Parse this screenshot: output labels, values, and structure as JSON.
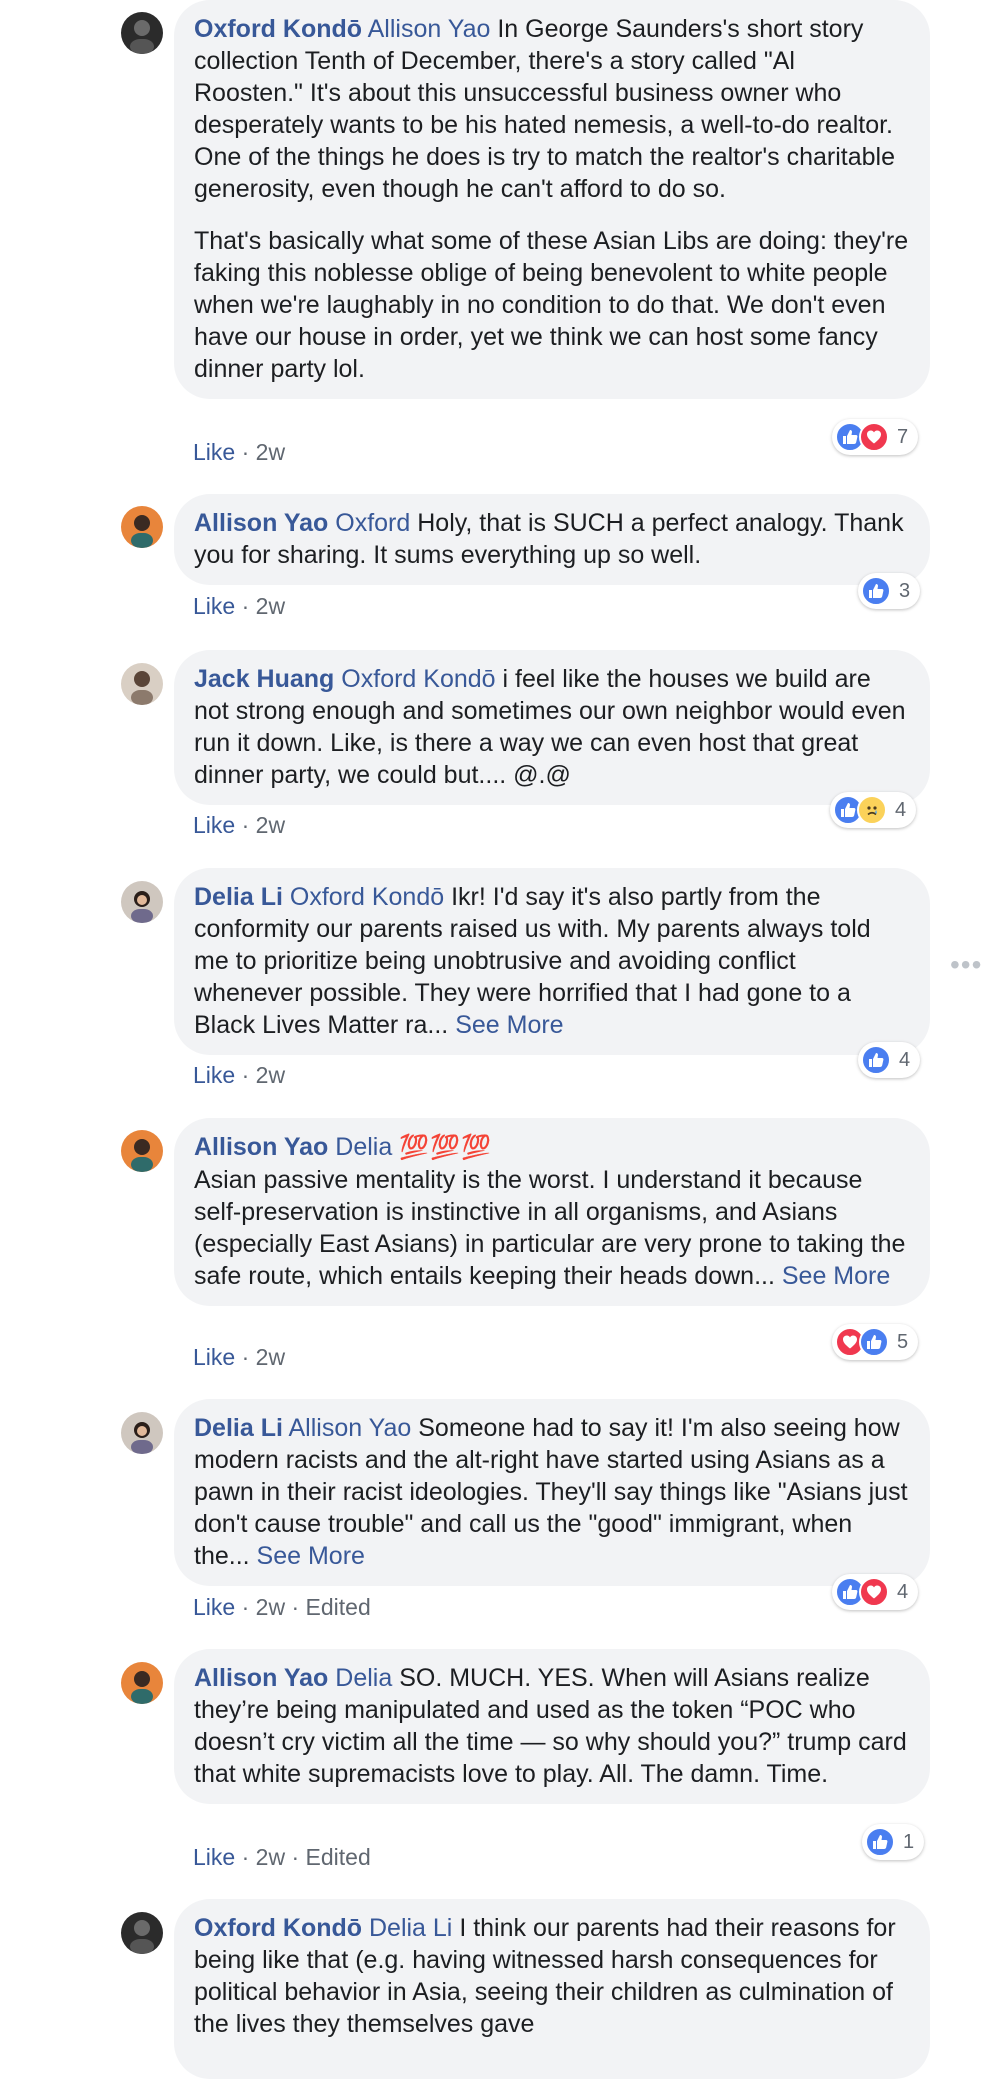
{
  "comments": [
    {
      "author": "Oxford Kondō",
      "mention": "Allison Yao",
      "paragraphs": [
        "In George Saunders's short story collection Tenth of December, there's a story called \"Al Roosten.\" It's about this unsuccessful business owner who desperately wants to be his hated nemesis, a well-to-do realtor. One of the things he does is try to match the realtor's charitable generosity, even though he can't afford to do so.",
        "That's basically what some of these Asian Libs are doing: they're faking this noblesse oblige of being benevolent to white people when we're laughably in no condition to do that. We don't even have our house in order, yet we think we can host some fancy dinner party lol."
      ],
      "like_label": "Like",
      "time": "2w",
      "edited": "",
      "reaction_icons": [
        "like-icon",
        "love-icon"
      ],
      "reaction_count": "7"
    },
    {
      "author": "Allison Yao",
      "mention": "Oxford",
      "text": "Holy, that is SUCH a perfect analogy. Thank you for sharing. It sums everything up so well.",
      "like_label": "Like",
      "time": "2w",
      "edited": "",
      "reaction_icons": [
        "like-icon"
      ],
      "reaction_count": "3"
    },
    {
      "author": "Jack Huang",
      "mention": "Oxford Kondō",
      "text": "i feel like the houses we build are not strong enough and sometimes our own neighbor would even run it down. Like, is there a way we can even host that great dinner party, we could but.... @.@",
      "like_label": "Like",
      "time": "2w",
      "edited": "",
      "reaction_icons": [
        "like-icon",
        "sad-icon"
      ],
      "reaction_count": "4"
    },
    {
      "author": "Delia Li",
      "mention": "Oxford Kondō",
      "text": "Ikr! I'd say it's also partly from the conformity our parents raised us with. My parents always told me to prioritize being unobtrusive and avoiding conflict whenever possible. They were horrified that I had gone to a Black Lives Matter ra...",
      "see_more": "See More",
      "like_label": "Like",
      "time": "2w",
      "edited": "",
      "reaction_icons": [
        "like-icon"
      ],
      "reaction_count": "4"
    },
    {
      "author": "Allison Yao",
      "mention": "Delia",
      "emoji": "💯💯💯",
      "text": "Asian passive mentality is the worst. I understand it because self-preservation is instinctive in all organisms, and Asians (especially East Asians) in particular are very prone to taking the safe route, which entails keeping their heads down...",
      "see_more": "See More",
      "like_label": "Like",
      "time": "2w",
      "edited": "",
      "reaction_icons": [
        "love-icon",
        "like-icon"
      ],
      "reaction_count": "5"
    },
    {
      "author": "Delia Li",
      "mention": "Allison Yao",
      "text": "Someone had to say it! I'm also seeing how modern racists and the alt-right have started using Asians as a pawn in their racist ideologies. They'll say things like \"Asians just don't cause trouble\" and call us the \"good\" immigrant, when the...",
      "see_more": "See More",
      "like_label": "Like",
      "time": "2w",
      "edited": "Edited",
      "reaction_icons": [
        "like-icon",
        "love-icon"
      ],
      "reaction_count": "4"
    },
    {
      "author": "Allison Yao",
      "mention": "Delia",
      "text": "SO. MUCH. YES. When will Asians realize they’re being manipulated and used as the token “POC who doesn’t cry victim all the time — so why should you?” trump card that white supremacists love to play. All. The damn. Time.",
      "like_label": "Like",
      "time": "2w",
      "edited": "Edited",
      "reaction_icons": [
        "like-icon"
      ],
      "reaction_count": "1"
    },
    {
      "author": "Oxford Kondō",
      "mention": "Delia Li",
      "text": "I think our parents had their reasons for being like that (e.g. having witnessed harsh consequences for political behavior in Asia, seeing their children as culmination of the lives they themselves gave"
    }
  ],
  "separator": "·",
  "more_icon": "more-options-icon"
}
